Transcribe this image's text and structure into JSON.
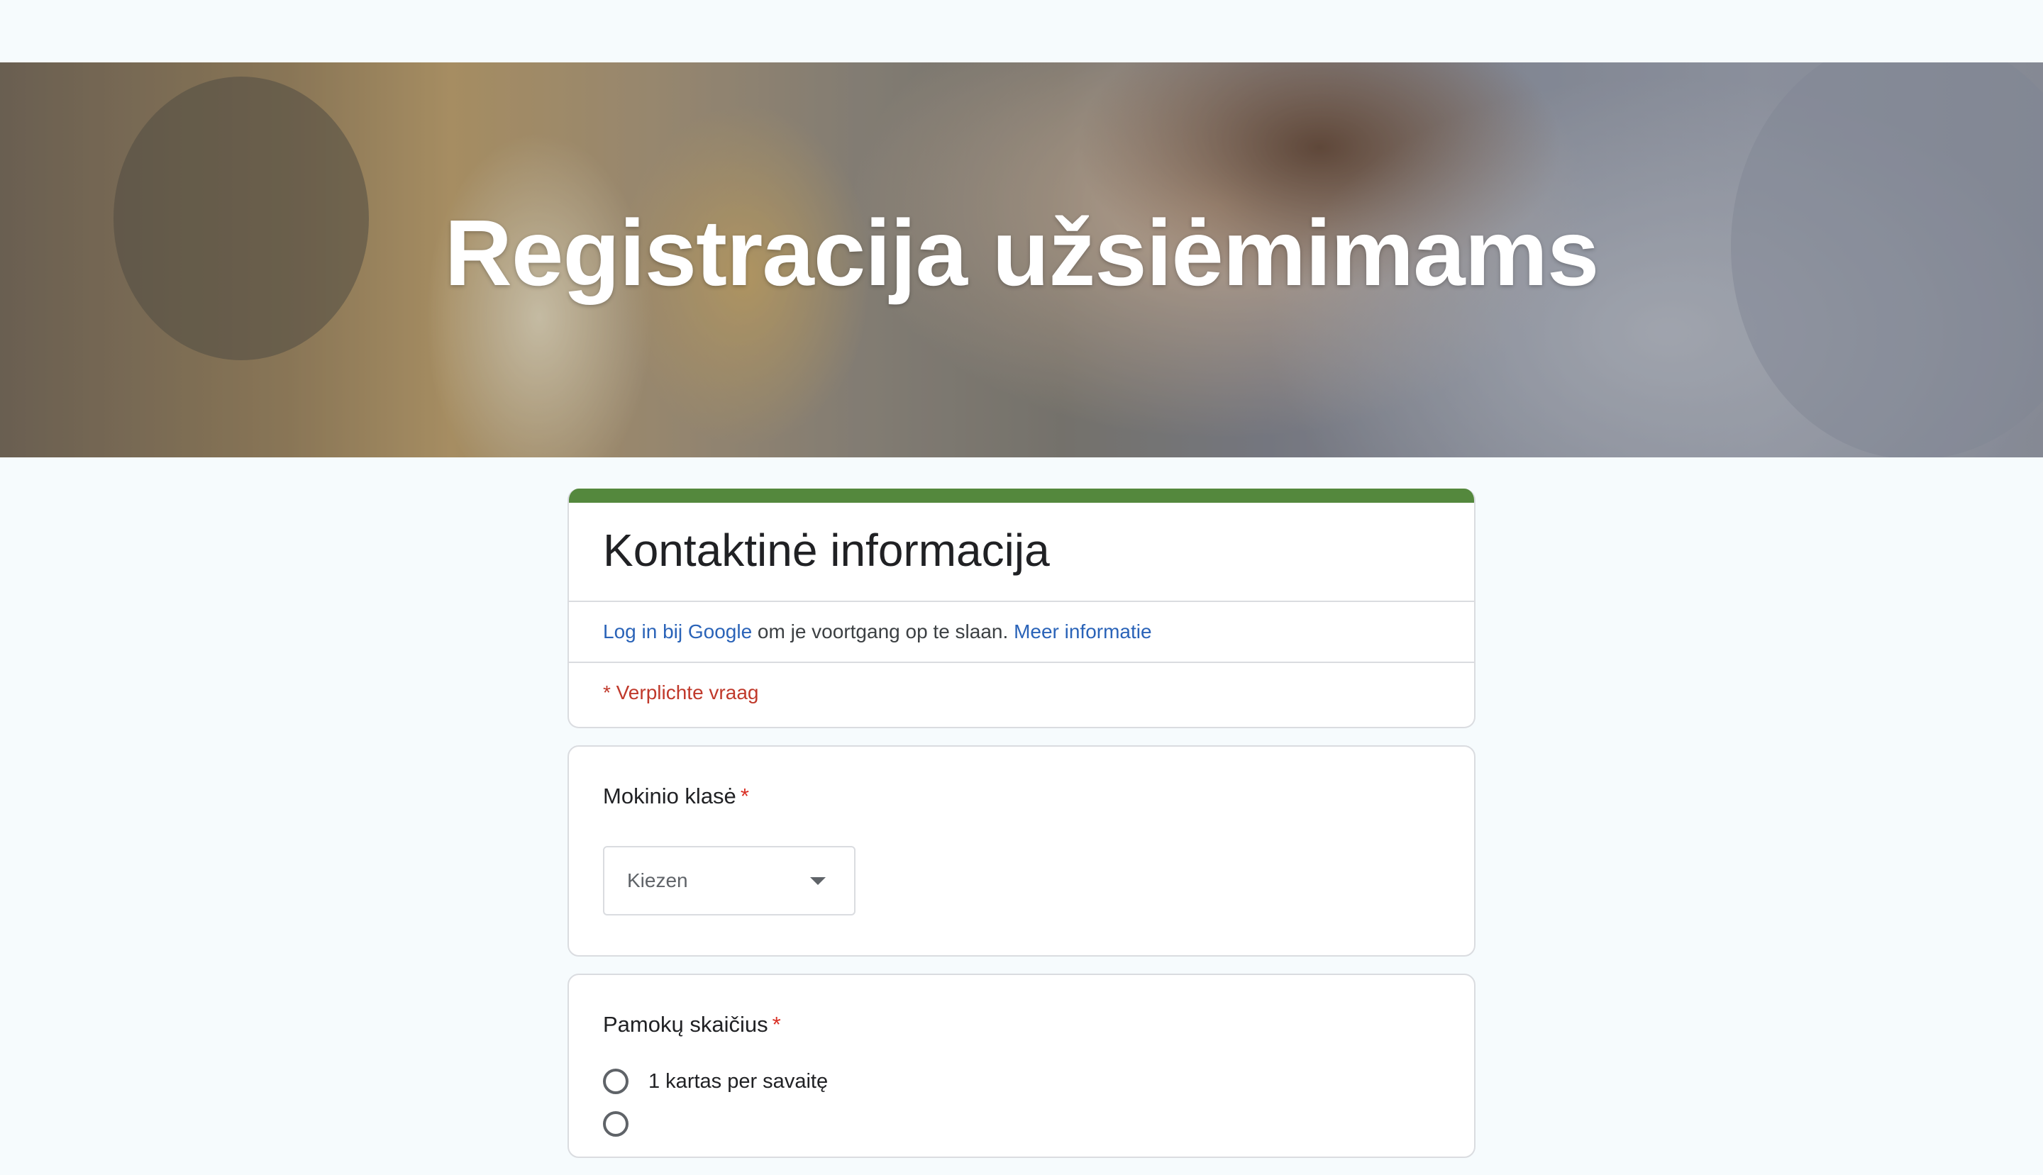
{
  "banner": {
    "title": "Registracija užsiėmimams"
  },
  "header": {
    "title": "Kontaktinė informacija",
    "login_link": "Log in bij Google",
    "login_text": " om je voortgang op te slaan. ",
    "more_info_link": "Meer informatie",
    "required_note": "* Verplichte vraag",
    "accent_color": "#54883d"
  },
  "questions": [
    {
      "title": "Mokinio klasė",
      "required_mark": "*",
      "type": "dropdown",
      "placeholder": "Kiezen"
    },
    {
      "title": "Pamokų skaičius",
      "required_mark": "*",
      "type": "radio",
      "options": [
        "1 kartas per savaitę"
      ]
    }
  ]
}
